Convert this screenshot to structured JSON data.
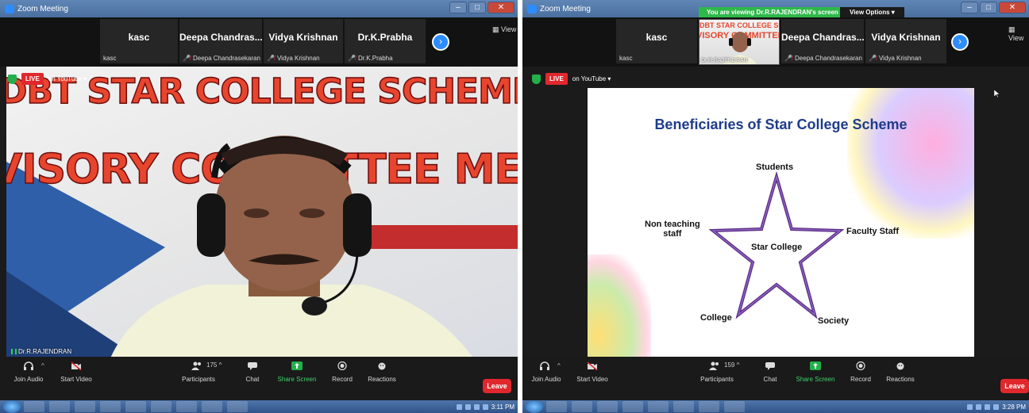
{
  "left": {
    "title": "Zoom Meeting",
    "view_label": "View",
    "participants_strip": [
      {
        "display": "kasc",
        "label": "kasc"
      },
      {
        "display": "Deepa Chandras...",
        "label": "Deepa Chandrasekaran"
      },
      {
        "display": "Vidya Krishnan",
        "label": "Vidya Krishnan"
      },
      {
        "display": "Dr.K.Prabha",
        "label": "Dr.K.Prabha"
      }
    ],
    "live_label": "LIVE",
    "live_platform": "on YouTube",
    "banner_line1": "DBT STAR COLLEGE SCHEME",
    "banner_line2": "VISORY COMMITTEE MEETI",
    "speaker_name": "Dr.R.RAJENDRAN",
    "participants_count": "175",
    "clock": "3:11 PM"
  },
  "right": {
    "title": "Zoom Meeting",
    "view_label": "View",
    "viewing_banner": "You are viewing Dr.R.RAJENDRAN's screen",
    "view_options": "View Options",
    "participants_strip": [
      {
        "display": "kasc",
        "label": "kasc"
      },
      {
        "display": "Deepa Chandras...",
        "label": "Deepa Chandrasekaran"
      },
      {
        "display": "Vidya Krishnan",
        "label": "Vidya Krishnan"
      }
    ],
    "thumbnail": {
      "line1": "DBT STAR COLLEGE SCHEME",
      "line2": "VISORY COMMITTEE MEETI",
      "name": "Dr.R.RAJENDRAN"
    },
    "live_label": "LIVE",
    "live_platform": "on YouTube",
    "slide": {
      "title": "Beneficiaries of Star College Scheme",
      "center": "Star College",
      "top": "Students",
      "left_line1": "Non teaching",
      "left_line2": "staff",
      "right": "Faculty Staff",
      "bottom_left": "College",
      "bottom_right": "Society"
    },
    "participants_count": "159",
    "clock": "3:28 PM"
  },
  "toolbar": {
    "join_audio": "Join Audio",
    "start_video": "Start Video",
    "participants": "Participants",
    "chat": "Chat",
    "share_screen": "Share Screen",
    "record": "Record",
    "reactions": "Reactions",
    "leave": "Leave"
  },
  "colors": {
    "zoom_blue": "#2d8cff",
    "live_red": "#e0282d",
    "share_green": "#23b04a",
    "slide_title": "#1d3c8c",
    "star_stroke": "#5b2d86"
  }
}
